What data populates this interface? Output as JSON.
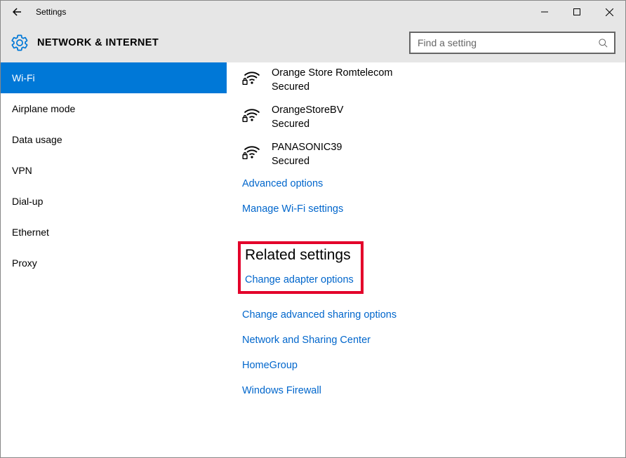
{
  "window": {
    "title": "Settings"
  },
  "header": {
    "page_title": "NETWORK & INTERNET",
    "search_placeholder": "Find a setting"
  },
  "sidebar": {
    "items": [
      {
        "label": "Wi-Fi",
        "selected": true
      },
      {
        "label": "Airplane mode",
        "selected": false
      },
      {
        "label": "Data usage",
        "selected": false
      },
      {
        "label": "VPN",
        "selected": false
      },
      {
        "label": "Dial-up",
        "selected": false
      },
      {
        "label": "Ethernet",
        "selected": false
      },
      {
        "label": "Proxy",
        "selected": false
      }
    ]
  },
  "content": {
    "networks": [
      {
        "name": "Orange Store Romtelecom",
        "status": "Secured"
      },
      {
        "name": "OrangeStoreBV",
        "status": "Secured"
      },
      {
        "name": "PANASONIC39",
        "status": "Secured"
      }
    ],
    "links_primary": [
      "Advanced options",
      "Manage Wi-Fi settings"
    ],
    "related_heading": "Related settings",
    "highlighted_link": "Change adapter options",
    "links_related": [
      "Change advanced sharing options",
      "Network and Sharing Center",
      "HomeGroup",
      "Windows Firewall"
    ]
  }
}
